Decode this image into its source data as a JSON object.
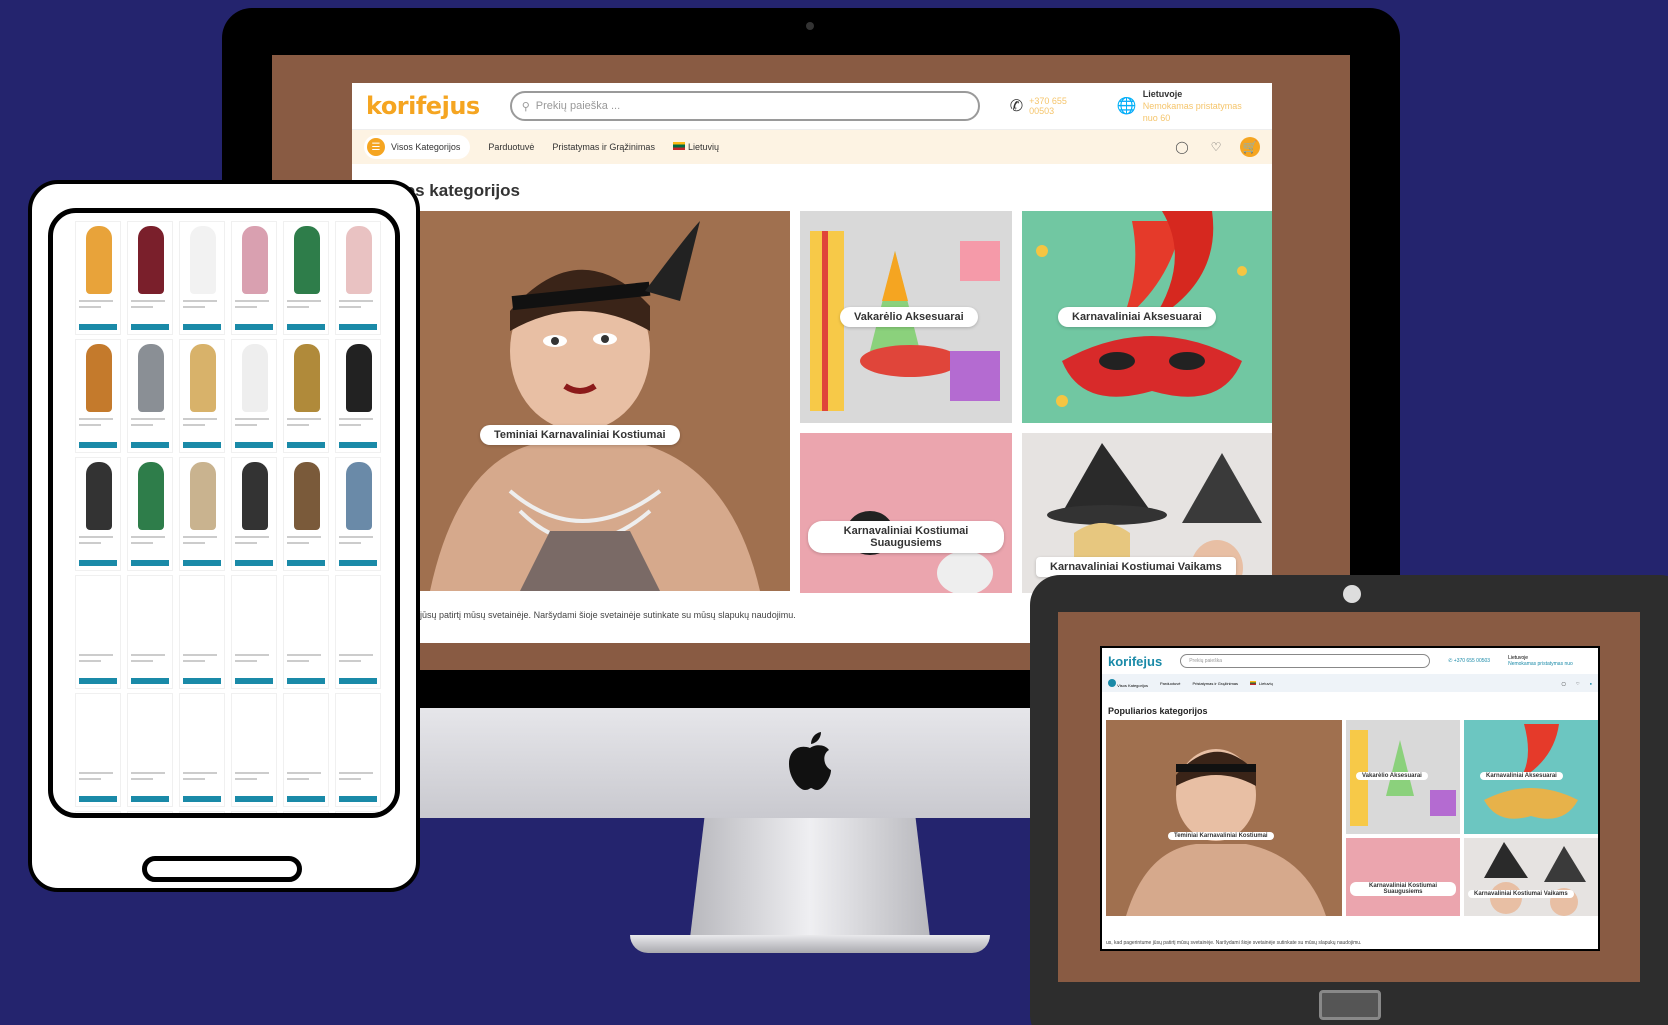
{
  "desktop": {
    "logo": "korifejus",
    "search_placeholder": "Prekių paieška ...",
    "phone": "+370 655 00503",
    "lang_title": "Lietuvoje",
    "lang_sub": "Nemokamas pristatymas nuo 60",
    "nav": {
      "categories": "Visos Kategorijos",
      "shop": "Parduotuvė",
      "delivery": "Pristatymas ir Grąžinimas",
      "language": "Lietuvių"
    },
    "section_title": "ios kategorijos",
    "tiles": {
      "big": "Teminiai Karnavaliniai Kostiumai",
      "party": "Vakarėlio Aksesuarai",
      "carnival": "Karnavaliniai Aksesuarai",
      "adults": "Karnavaliniai Kostiumai Suaugusiems",
      "kids": "Karnavaliniai Kostiumai Vaikams"
    },
    "cookie": "ume jūsų patirtį mūsų svetainėje. Naršydami šioje svetainėje sutinkate su mūsų slapukų naudojimu."
  },
  "tablet_landscape": {
    "logo": "korifejus",
    "search_placeholder": "Prekių paieška",
    "phone": "+370 655 00503",
    "lang_title": "Lietuvoje",
    "lang_sub": "Nemokamas pristatymas nuo",
    "nav": {
      "categories": "Visos Kategorijos",
      "shop": "Parduotuvė",
      "delivery": "Pristatymas ir Grąžinimas",
      "language": "Lietuvių"
    },
    "section_title": "Populiarios kategorijos",
    "tiles": {
      "big": "Teminiai Karnavaliniai Kostiumai",
      "party": "Vakarėlio Aksesuarai",
      "carnival": "Karnavaliniai Aksesuarai",
      "adults": "Karnavaliniai Kostiumai Suaugusiems",
      "kids": "Karnavaliniai Kostiumai Vaikams"
    },
    "cookie": "us, kad pagerintume jūsų patirtį mūsų svetainėje. Naršydami šioje svetainėje sutinkate su mūsų slapukų naudojimu."
  },
  "colors": {
    "background": "#24246e",
    "brand_orange": "#f5a521",
    "brand_teal": "#1a8aa8",
    "screen_brown": "#895b43"
  },
  "icons": [
    "search-icon",
    "phone-icon",
    "globe-icon",
    "user-icon",
    "heart-icon",
    "cart-icon",
    "menu-icon",
    "apple-logo-icon"
  ]
}
